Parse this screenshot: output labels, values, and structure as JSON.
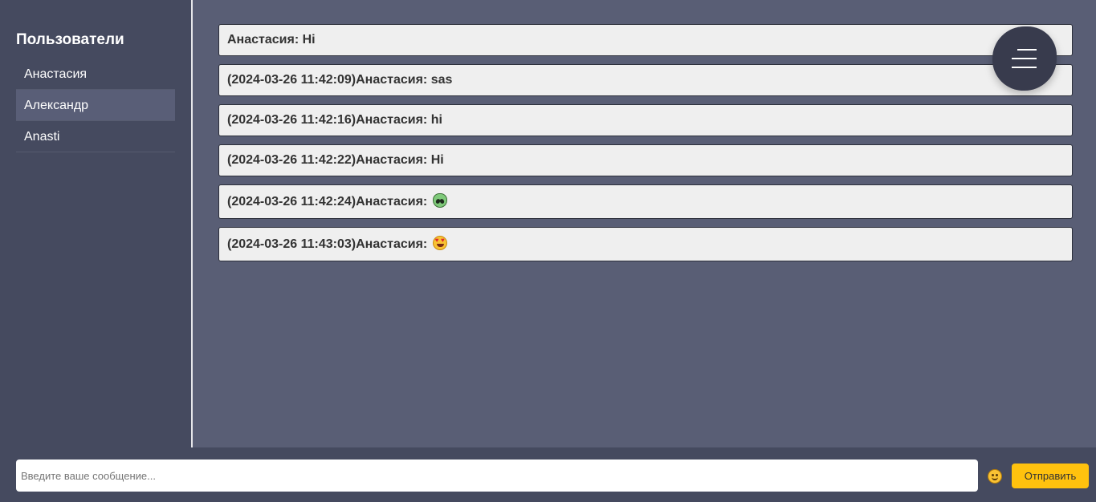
{
  "sidebar": {
    "title": "Пользователи",
    "users": [
      {
        "name": "Анастасия",
        "active": false
      },
      {
        "name": "Александр",
        "active": true
      },
      {
        "name": "Anasti",
        "active": false
      }
    ]
  },
  "messages": [
    {
      "text": "Анастасия: Hi"
    },
    {
      "text": "(2024-03-26 11:42:09)Анастасия: sas"
    },
    {
      "text": "(2024-03-26 11:42:16)Анастасия: hi"
    },
    {
      "text": "(2024-03-26 11:42:22)Анастасия: Hi"
    },
    {
      "text": "(2024-03-26 11:42:24)Анастасия: ",
      "emoji": "alien-emoji"
    },
    {
      "text": "(2024-03-26 11:43:03)Анастасия: ",
      "emoji": "heart-eyes-emoji"
    }
  ],
  "menu": {
    "icon": "hamburger-menu-icon"
  },
  "composer": {
    "placeholder": "Введите ваше сообщение...",
    "value": "",
    "emoji_icon": "smiley-icon",
    "send_label": "Отправить"
  },
  "colors": {
    "sidebar_bg": "#454a5f",
    "chat_bg": "#595e75",
    "message_bg": "#efefef",
    "accent": "#ffc20e",
    "menu_bg": "#383b4d"
  }
}
